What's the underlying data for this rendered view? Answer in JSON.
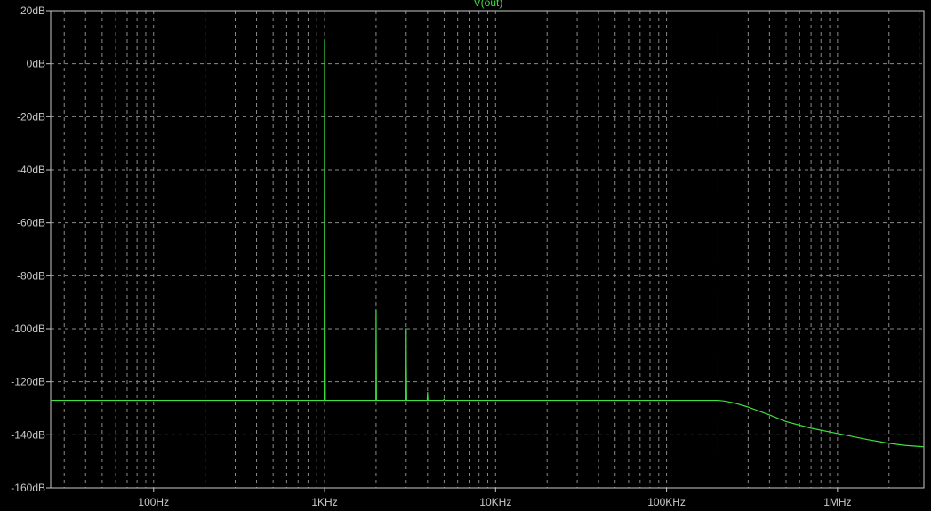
{
  "chart_data": {
    "type": "line",
    "title": "",
    "xlabel": "",
    "ylabel": "",
    "x_scale": "log",
    "xlim": [
      25,
      3200000
    ],
    "ylim": [
      -160,
      20
    ],
    "grid": true,
    "colors": {
      "background": "#000000",
      "trace": "#3fdf3f",
      "grid": "#8a8a8a",
      "axis_text": "#c8c8c8"
    },
    "y_ticks": [
      {
        "value": 20,
        "label": "20dB"
      },
      {
        "value": 0,
        "label": "0dB"
      },
      {
        "value": -20,
        "label": "-20dB"
      },
      {
        "value": -40,
        "label": "-40dB"
      },
      {
        "value": -60,
        "label": "-60dB"
      },
      {
        "value": -80,
        "label": "-80dB"
      },
      {
        "value": -100,
        "label": "-100dB"
      },
      {
        "value": -120,
        "label": "-120dB"
      },
      {
        "value": -140,
        "label": "-140dB"
      },
      {
        "value": -160,
        "label": "-160dB"
      }
    ],
    "x_ticks": [
      {
        "value": 100,
        "label": "100Hz"
      },
      {
        "value": 1000,
        "label": "1KHz"
      },
      {
        "value": 10000,
        "label": "10KHz"
      },
      {
        "value": 100000,
        "label": "100KHz"
      },
      {
        "value": 1000000,
        "label": "1MHz"
      }
    ],
    "series": [
      {
        "name": "V(out)",
        "x": [
          25,
          990,
          995,
          1000,
          1002,
          1005,
          1010,
          1020,
          1980,
          1995,
          2000,
          2005,
          2010,
          2020,
          2980,
          2995,
          3000,
          3005,
          3020,
          3980,
          4000,
          4020,
          4950,
          5000,
          5050,
          200000,
          220000,
          250000,
          300000,
          400000,
          500000,
          700000,
          1000000,
          1500000,
          2000000,
          2500000,
          3200000
        ],
        "values": [
          -127,
          -127,
          -127,
          9,
          -25,
          -93,
          -127,
          -127,
          -127,
          -127,
          -93,
          -110,
          -127,
          -127,
          -127,
          -127,
          -100,
          -113,
          -127,
          -127,
          -124,
          -127,
          -127,
          -126.5,
          -127,
          -127,
          -127.3,
          -128,
          -129.5,
          -132.5,
          -135,
          -137.5,
          -139.5,
          -141.8,
          -143.2,
          -144,
          -144.5
        ]
      }
    ]
  }
}
